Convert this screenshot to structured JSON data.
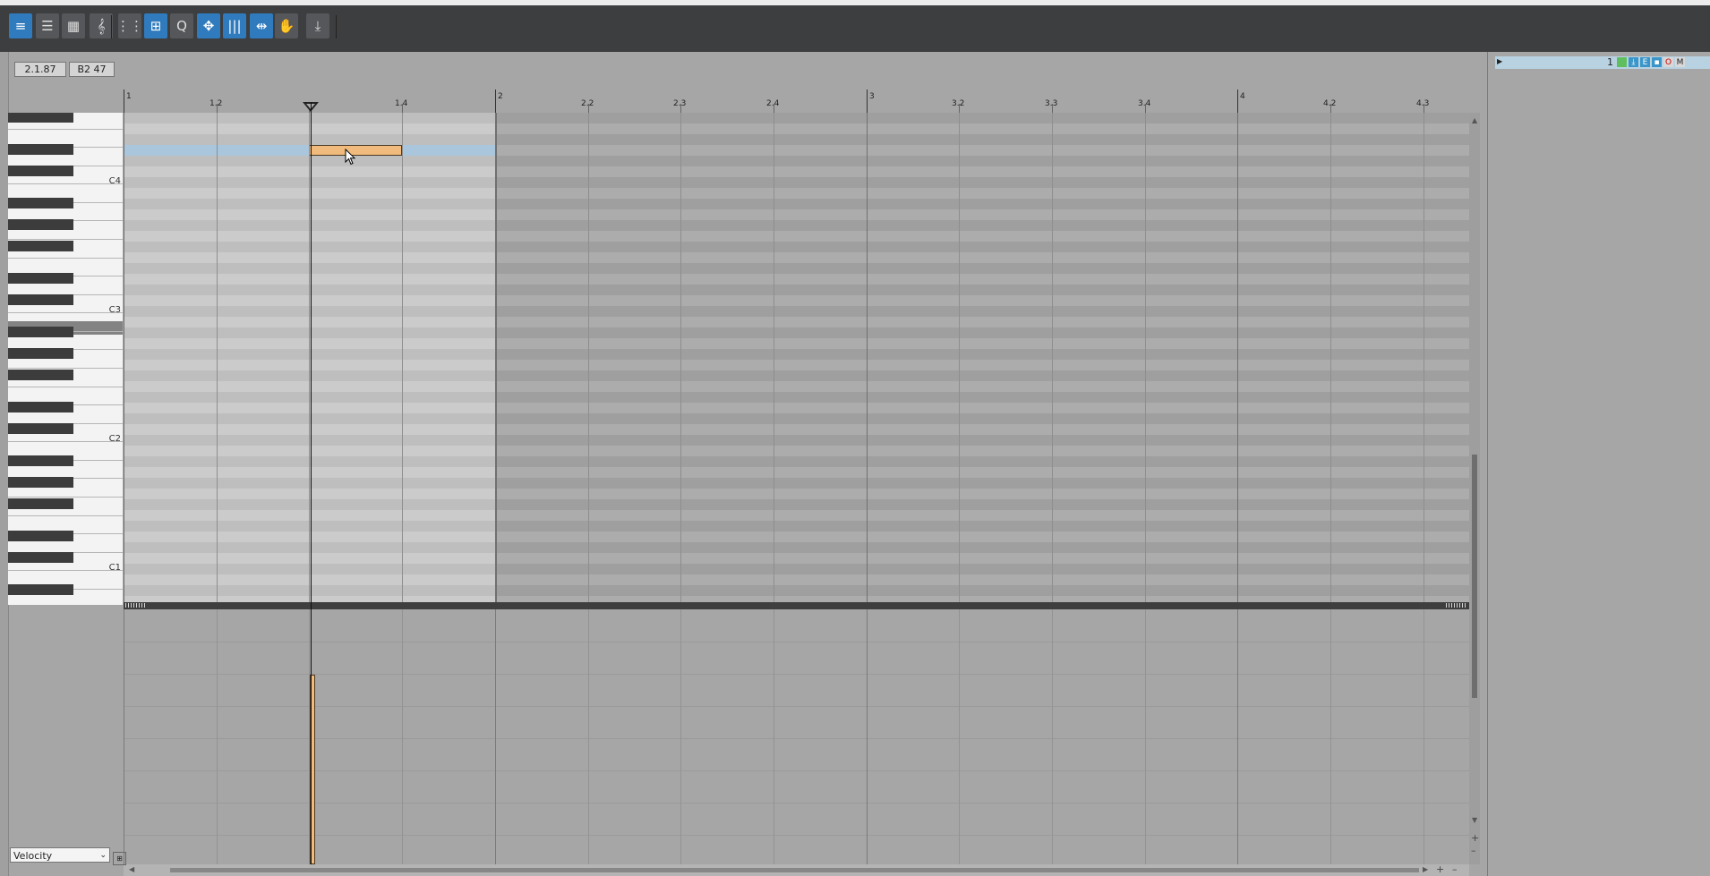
{
  "toolbar": {
    "buttons": [
      {
        "name": "piano-roll-view-button",
        "glyph": "≡",
        "state": "on"
      },
      {
        "name": "list-view-button",
        "glyph": "☰",
        "state": "off"
      },
      {
        "name": "grid-view-button",
        "glyph": "▦",
        "state": "off"
      },
      {
        "name": "staff-view-button",
        "glyph": "𝄞",
        "state": "off"
      },
      {
        "name": "snap-grid-button",
        "glyph": "⋮⋮",
        "state": "off"
      },
      {
        "name": "snap-to-notes-button",
        "glyph": "⊞",
        "state": "on"
      },
      {
        "name": "quantize-button",
        "glyph": "Q",
        "state": "off"
      },
      {
        "name": "select-tool-button",
        "glyph": "✥",
        "state": "on"
      },
      {
        "name": "split-tool-button",
        "glyph": "|||",
        "state": "on"
      },
      {
        "name": "glue-tool-button",
        "glyph": "⇹",
        "state": "on"
      },
      {
        "name": "step-record-button",
        "glyph": "✋",
        "state": "off"
      },
      {
        "name": "import-button",
        "glyph": "⤓",
        "state": "off"
      }
    ]
  },
  "info": {
    "position": "2.1.87",
    "pitch": "B2  47"
  },
  "ruler": {
    "labels": [
      "1",
      "1.2",
      "",
      "1.4",
      "2",
      "2.2",
      "2.3",
      "2.4",
      "3",
      "3.2",
      "3.3",
      "3.4",
      "4",
      "4.2",
      "4.3"
    ]
  },
  "keyboard": {
    "labels": [
      "C4",
      "C3",
      "C2",
      "C1"
    ]
  },
  "track": {
    "number": "1",
    "buttons": [
      "E",
      "O",
      "M"
    ]
  },
  "note": {
    "start": "1.3",
    "end": "1.4",
    "pitch": "B2  47"
  },
  "velocity_panel": {
    "selector": "Velocity"
  },
  "colors": {
    "note": "#f0bb7d",
    "selected_row": "#aac6dd",
    "toolbar_active": "#2f7bbd",
    "toolbar_bg": "#3d3e40"
  }
}
